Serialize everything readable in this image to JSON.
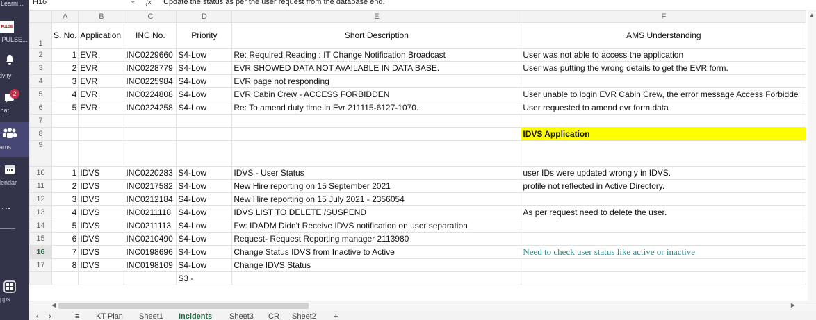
{
  "rail": {
    "top_label": "s Learni...",
    "pulse_label": "S PULSE...",
    "activity": "ctivity",
    "chat": "Chat",
    "chat_badge": "2",
    "teams": "eams",
    "calendar": "alendar",
    "more": "...",
    "apps": "Apps"
  },
  "formula": {
    "cell": "H16",
    "fx": "fx",
    "text": "Update the status as per the user request from the database end."
  },
  "columns": [
    "A",
    "B",
    "C",
    "D",
    "E",
    "F"
  ],
  "header": {
    "sno": "S. No.",
    "app": "Application",
    "inc": "INC No.",
    "priority": "Priority",
    "desc": "Short Description",
    "ams": "AMS Understanding"
  },
  "rows": [
    {
      "n": "2",
      "sno": "1",
      "app": "EVR",
      "inc": "INC0229660",
      "pri": "S4-Low",
      "desc": "Re: Required Reading : IT Change Notification Broadcast",
      "ams": "User was not able to access the application"
    },
    {
      "n": "3",
      "sno": "2",
      "app": "EVR",
      "inc": "INC0228779",
      "pri": "S4-Low",
      "desc": "EVR SHOWED DATA NOT AVAILABLE IN DATA BASE.",
      "ams": "User was putting the wrong details to get the EVR form."
    },
    {
      "n": "4",
      "sno": "3",
      "app": "EVR",
      "inc": "INC0225984",
      "pri": "S4-Low",
      "desc": "EVR page not responding",
      "ams": ""
    },
    {
      "n": "5",
      "sno": "4",
      "app": "EVR",
      "inc": "INC0224808",
      "pri": "S4-Low",
      "desc": "EVR Cabin Crew - ACCESS FORBIDDEN",
      "ams": "User unable to login EVR Cabin Crew, the error message Access Forbidde"
    },
    {
      "n": "6",
      "sno": "5",
      "app": "EVR",
      "inc": "INC0224258",
      "pri": "S4-Low",
      "desc": "Re: To amend duty time in Evr 211115-6127-1070.",
      "ams": "User requested to amend evr form data"
    }
  ],
  "row7": "7",
  "row8": {
    "n": "8",
    "ams": "IDVS Application"
  },
  "row9": "9",
  "rows2": [
    {
      "n": "10",
      "sno": "1",
      "app": "IDVS",
      "inc": "INC0220283",
      "pri": "S4-Low",
      "desc": "IDVS - User Status",
      "ams": "user IDs were updated wrongly in IDVS."
    },
    {
      "n": "11",
      "sno": "2",
      "app": "IDVS",
      "inc": "INC0217582",
      "pri": "S4-Low",
      "desc": "New Hire reporting on 15 September 2021",
      "ams": "profile not reflected in Active Directory."
    },
    {
      "n": "12",
      "sno": "3",
      "app": "IDVS",
      "inc": "INC0212184",
      "pri": "S4-Low",
      "desc": "New Hire reporting on 15 July 2021 - 2356054",
      "ams": ""
    },
    {
      "n": "13",
      "sno": "4",
      "app": "IDVS",
      "inc": "INC0211118",
      "pri": "S4-Low",
      "desc": "IDVS LIST TO DELETE /SUSPEND",
      "ams": "As per request need to delete the user."
    },
    {
      "n": "14",
      "sno": "5",
      "app": "IDVS",
      "inc": "INC0211113",
      "pri": "S4-Low",
      "desc": "Fw: IDADM Didn't Receive IDVS notification on user separation",
      "ams": ""
    },
    {
      "n": "15",
      "sno": "6",
      "app": "IDVS",
      "inc": "INC0210490",
      "pri": "S4-Low",
      "desc": "Request- Request Reporting manager 2113980",
      "ams": ""
    },
    {
      "n": "16",
      "sno": "7",
      "app": "IDVS",
      "inc": "INC0198696",
      "pri": "S4-Low",
      "desc": "Change Status IDVS from Inactive to Active",
      "ams": "Need to check user status like active or inactive"
    },
    {
      "n": "17",
      "sno": "8",
      "app": "IDVS",
      "inc": "INC0198109",
      "pri": "S4-Low",
      "desc": "Change IDVS Status",
      "ams": ""
    }
  ],
  "row18_pri": "S3 -",
  "tabs": [
    "KT Plan",
    "Sheet1",
    "Incidents",
    "Sheet3",
    "CR",
    "Sheet2",
    "+"
  ]
}
